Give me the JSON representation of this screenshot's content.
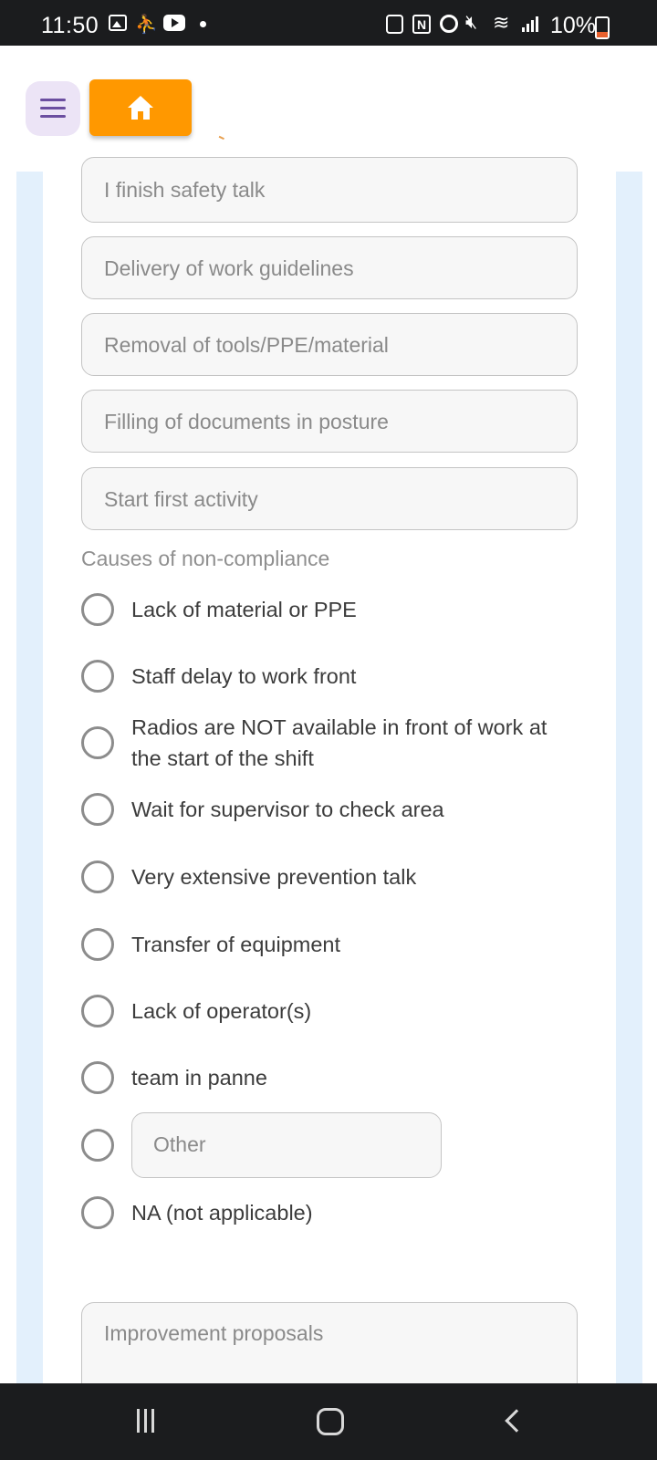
{
  "status_bar": {
    "time": "11:50",
    "battery_percent": "10%",
    "icons": [
      "gallery-icon",
      "person-icon",
      "youtube-icon",
      "notification-dot-icon",
      "lock-app-icon",
      "nfc-icon",
      "alarm-icon",
      "mute-icon",
      "wifi-icon",
      "signal-icon",
      "battery-low-icon"
    ]
  },
  "header": {
    "menu_icon": "hamburger-menu-icon",
    "home_icon": "home-icon",
    "home_button_color": "#ff9800"
  },
  "fields": [
    {
      "label": "I finish safety talk"
    },
    {
      "label": "Delivery of work guidelines"
    },
    {
      "label": "Removal of tools/PPE/material"
    },
    {
      "label": "Filling of documents in posture"
    },
    {
      "label": "Start first activity"
    }
  ],
  "causes": {
    "title": "Causes of non-compliance",
    "options": [
      {
        "label": "Lack of material or PPE",
        "selected": false
      },
      {
        "label": "Staff delay to work front",
        "selected": false
      },
      {
        "label": "Radios are NOT available in front of work at the start of the shift",
        "selected": false
      },
      {
        "label": "Wait for supervisor to check area",
        "selected": false
      },
      {
        "label": "Very extensive prevention talk",
        "selected": false
      },
      {
        "label": "Transfer of equipment",
        "selected": false
      },
      {
        "label": "Lack of operator(s)",
        "selected": false
      },
      {
        "label": "team in panne",
        "selected": false
      },
      {
        "label": "Other",
        "selected": false,
        "is_input": true
      },
      {
        "label": "NA (not applicable)",
        "selected": false
      }
    ]
  },
  "improvement": {
    "label": "Improvement proposals"
  },
  "nav_bar": {
    "icons": [
      "recents-icon",
      "home-nav-icon",
      "back-icon"
    ]
  },
  "colors": {
    "accent": "#ff9800",
    "side_panel": "#e3f0fc",
    "menu_button_bg": "#ece4f6"
  }
}
